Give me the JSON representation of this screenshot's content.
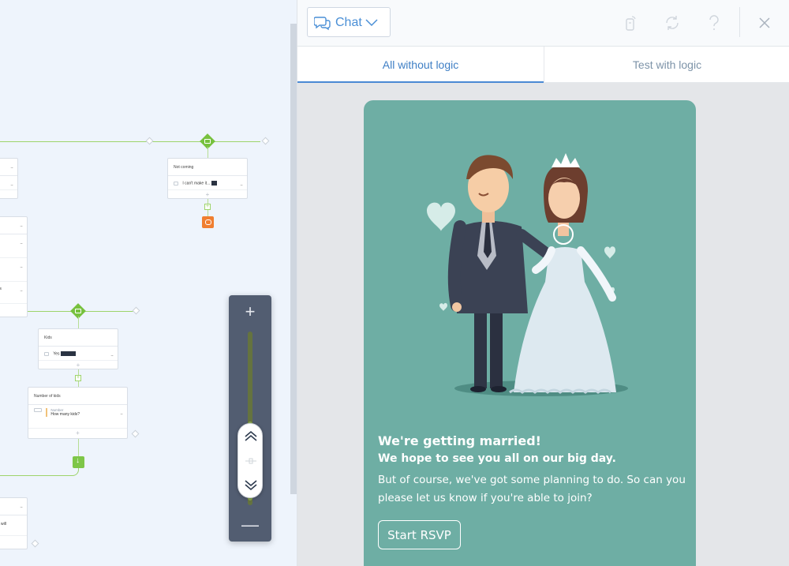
{
  "canvas": {
    "nodes": {
      "not_coming": {
        "title": "Not coming",
        "row_text": "I can't make it..."
      },
      "kids": {
        "title": "Kids",
        "row_yes": "Yes"
      },
      "number_of_kids": {
        "title": "Number of kids",
        "field_type": "Number",
        "question": "How many kids?"
      },
      "partial_left": {
        "row1": "kids",
        "row2": "will"
      }
    },
    "zoom": {
      "in_symbol": "+",
      "out_symbol": "—",
      "level": 0.45
    }
  },
  "panel": {
    "chat_select": {
      "label": "Chat",
      "icon": "chat-bubbles-icon"
    },
    "toolbar_icons": [
      "test-device-icon",
      "refresh-icon",
      "help-icon",
      "close-icon"
    ],
    "tabs": [
      {
        "label": "All without logic",
        "active": true
      },
      {
        "label": "Test with logic",
        "active": false
      }
    ],
    "card": {
      "heading": "We're getting married!",
      "subheading": "We hope to see you all on our big day.",
      "body": "But of course, we've got some planning to do. So can you please let us know if you're able to join?",
      "button_label": "Start RSVP",
      "background": "#6eaea4"
    }
  },
  "colors": {
    "accent": "#4b8ad4",
    "flow_green": "#77c13e",
    "flow_orange": "#f07e30",
    "zoom_bg": "#525d71"
  }
}
